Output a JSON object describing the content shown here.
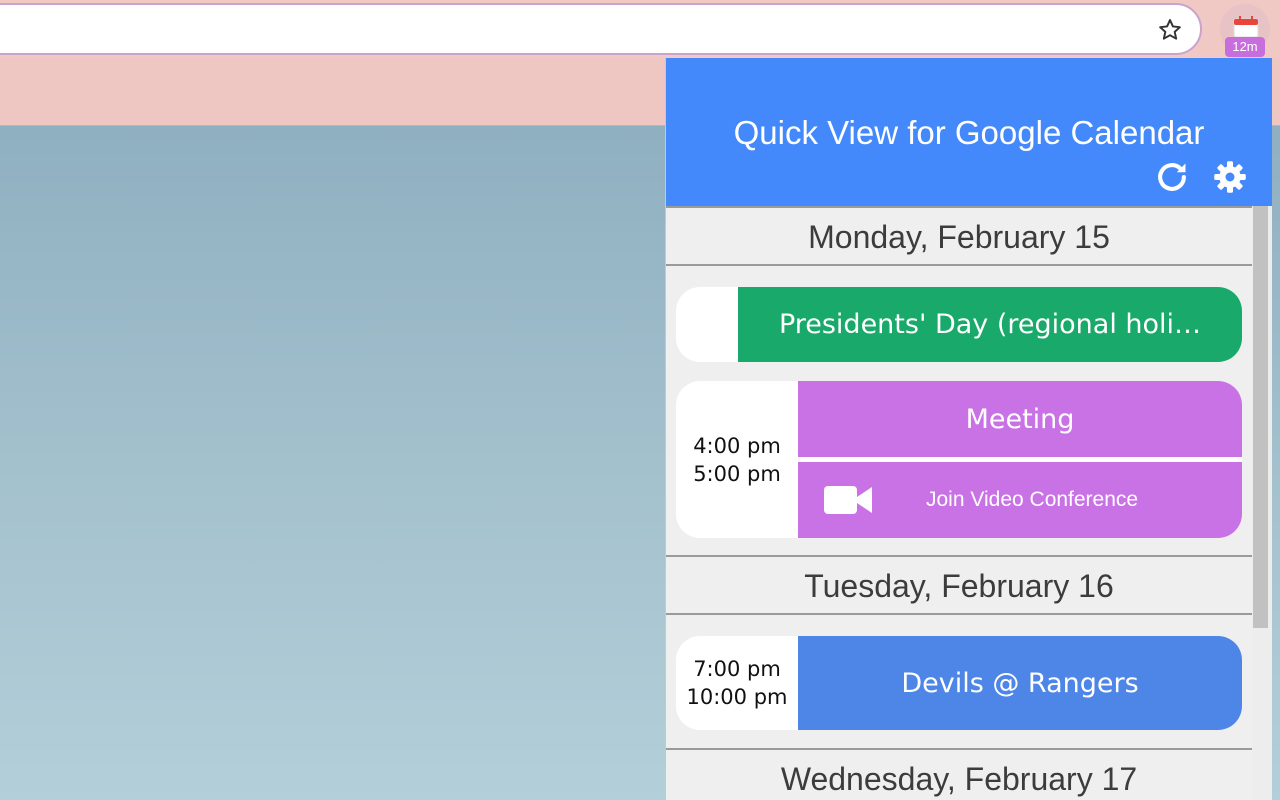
{
  "browser": {
    "extension_badge": "12m",
    "icons": [
      "star-icon",
      "calendar-icon"
    ]
  },
  "popup": {
    "title": "Quick View for Google Calendar",
    "icons": [
      "refresh-icon",
      "gear-icon",
      "video-camera-icon"
    ],
    "colors": {
      "header": "#4489fb",
      "holiday": "#19a96a",
      "meeting": "#c972e6",
      "game": "#4d86e6"
    },
    "days": [
      {
        "label": "Monday, February 15",
        "events": [
          {
            "title": "Presidents' Day (regional holi…",
            "all_day": true
          },
          {
            "title": "Meeting",
            "start": "4:00 pm",
            "end": "5:00 pm",
            "conference_label": "Join Video Conference"
          }
        ]
      },
      {
        "label": "Tuesday, February 16",
        "events": [
          {
            "title": "Devils @ Rangers",
            "start": "7:00 pm",
            "end": "10:00 pm"
          }
        ]
      },
      {
        "label": "Wednesday, February 17",
        "events": []
      }
    ]
  }
}
